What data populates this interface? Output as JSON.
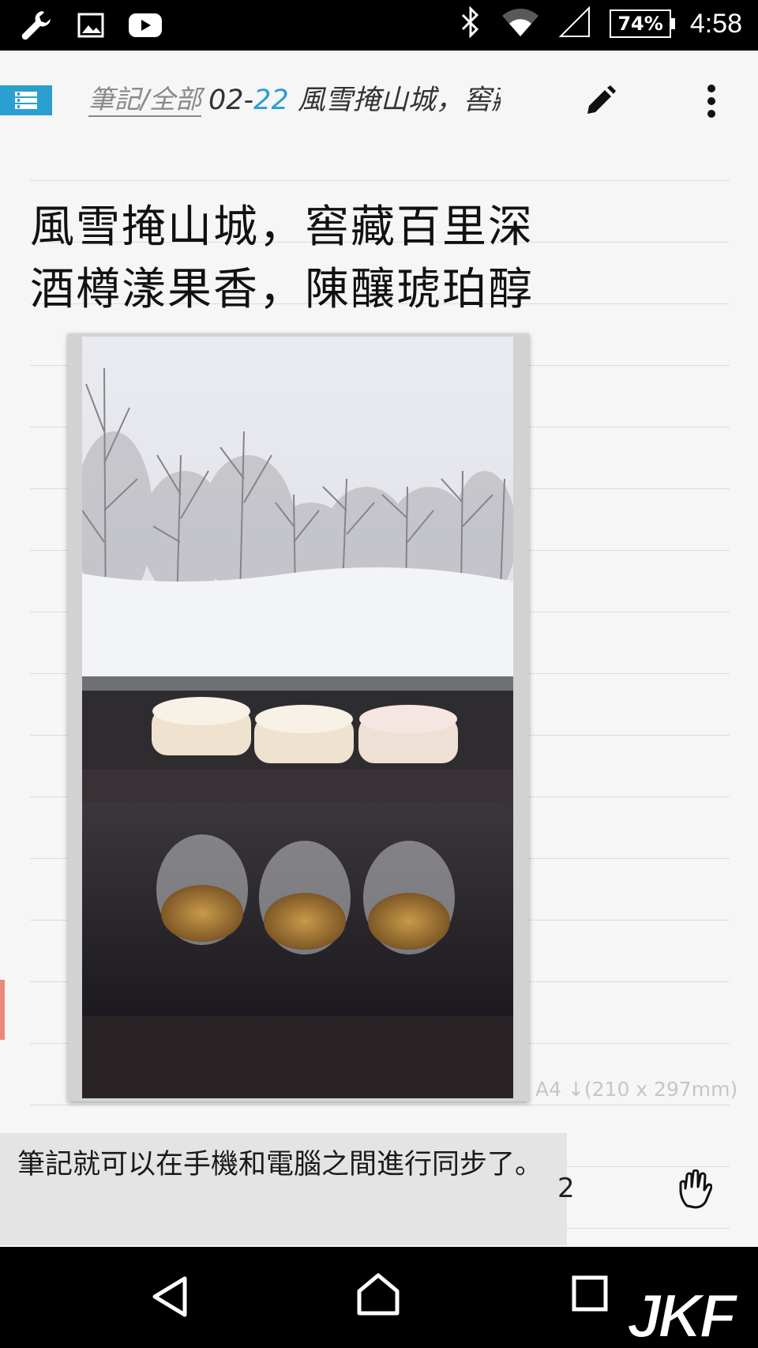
{
  "status_bar": {
    "battery": "74%",
    "time": "4:58",
    "icons": [
      "wrench-icon",
      "image-icon",
      "youtube-icon",
      "bluetooth-icon",
      "wifi-icon",
      "signal-icon",
      "battery-icon"
    ]
  },
  "toolbar": {
    "breadcrumb": "筆記/全部",
    "note_date_prefix": "02-",
    "note_date_day": "22",
    "note_title": " 風雪掩山城，窖藏百里深"
  },
  "note": {
    "heading_line1": "風雪掩山城，窖藏百里深",
    "heading_line2": "酒樽漾果香，陳釀琥珀醇",
    "paper_size": "A4 ↓(210 x 297mm)"
  },
  "toast": {
    "message": "筆記就可以在手機和電腦之間進行同步了。"
  },
  "peek_text": "2",
  "watermark": "JKF",
  "colors": {
    "accent": "#2a9fd0",
    "statusbar": "#000000",
    "page": "#f6f6f6"
  }
}
